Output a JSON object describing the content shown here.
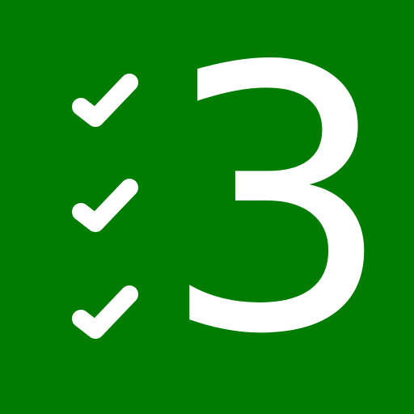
{
  "icon": {
    "digit": "3",
    "background_color": "#007c00",
    "foreground_color": "#ffffff",
    "checkmarks": [
      {
        "icon": "checkmark-icon"
      },
      {
        "icon": "checkmark-icon"
      },
      {
        "icon": "checkmark-icon"
      }
    ]
  }
}
